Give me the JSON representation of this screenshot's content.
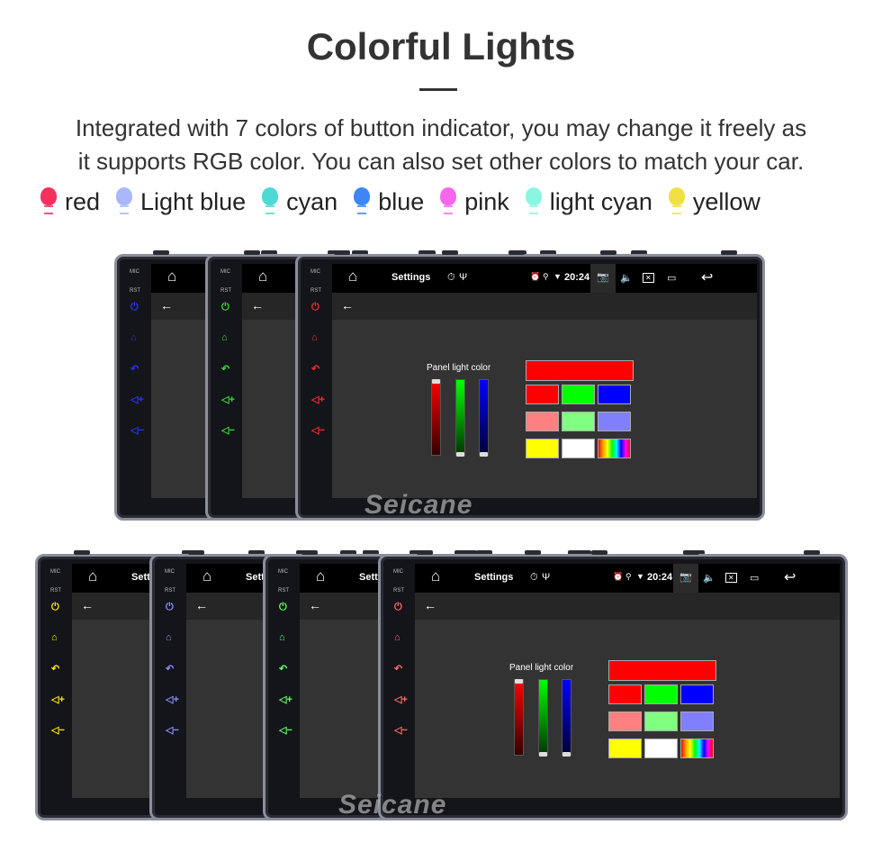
{
  "title": "Colorful Lights",
  "description": [
    "Integrated with 7 colors of button indicator, you may change it freely as",
    "it supports RGB color. You can also set other colors to match your car."
  ],
  "legend": [
    {
      "label": "red",
      "color": "#f4305f"
    },
    {
      "label": "Light blue",
      "color": "#aab8fb"
    },
    {
      "label": "cyan",
      "color": "#4fd9d4"
    },
    {
      "label": "blue",
      "color": "#3d86f6"
    },
    {
      "label": "pink",
      "color": "#f966ee"
    },
    {
      "label": "light cyan",
      "color": "#8cf5e2"
    },
    {
      "label": "yellow",
      "color": "#f1e043"
    }
  ],
  "device": {
    "mic": "MIC",
    "rst": "RST",
    "settings": "Settings",
    "time": "20:24",
    "panel_label": "Panel light color",
    "bottom_partial_title": "Setti"
  },
  "watermark": "Seicane",
  "top_row_button_colors": [
    "#2b35ff",
    "#33e033",
    "#ff2a2a"
  ],
  "bottom_row_button_colors": [
    "#ffe800",
    "#8f8fff",
    "#66ff66",
    "#ff6b6b"
  ],
  "palette": {
    "wide": "#ff0000",
    "cells": [
      "#ff0000",
      "#00ff00",
      "#0000ff",
      "#ff8080",
      "#80ff80",
      "#8080ff",
      "#ffff00",
      "#ffffff",
      "rainbow"
    ]
  }
}
